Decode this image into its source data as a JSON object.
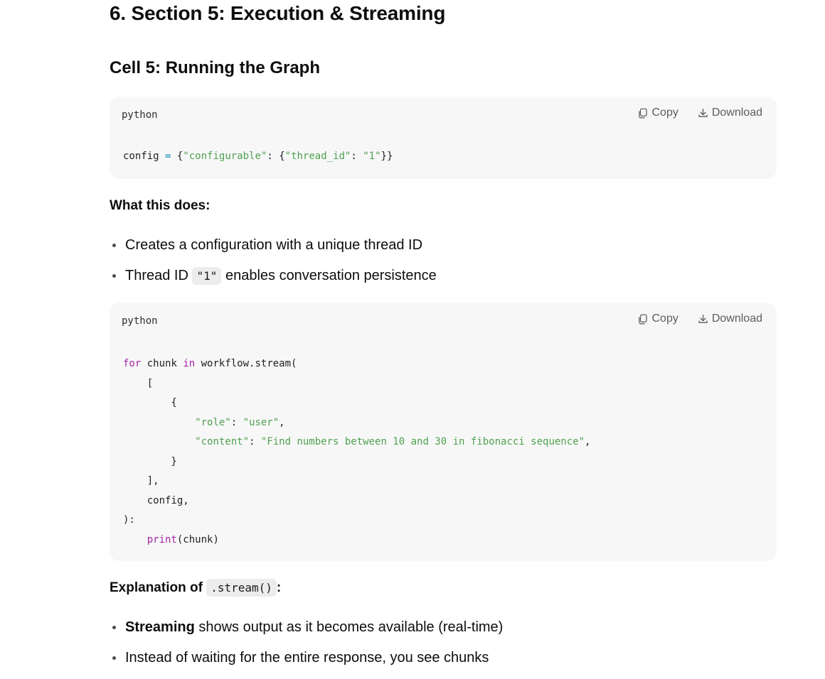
{
  "section_title": "6. Section 5: Execution & Streaming",
  "cell_title": "Cell 5: Running the Graph",
  "code_block_1": {
    "lang": "python",
    "copy_label": "Copy",
    "download_label": "Download",
    "tokens": [
      "config",
      " ",
      "=",
      " ",
      "{",
      "\"configurable\"",
      ": ",
      "{",
      "\"thread_id\"",
      ": ",
      "\"1\"",
      "}}"
    ]
  },
  "what_this_does": {
    "heading": "What this does:",
    "bullet_1": "Creates a configuration with a unique thread ID",
    "bullet_2_pre": "Thread ID ",
    "bullet_2_code": "\"1\"",
    "bullet_2_post": " enables conversation persistence"
  },
  "code_block_2": {
    "lang": "python",
    "copy_label": "Copy",
    "download_label": "Download",
    "l1_kw": "for",
    "l1_a": " chunk ",
    "l1_kw2": "in",
    "l1_b": " workflow.stream(",
    "l2": "    [",
    "l3": "        {",
    "l4_key": "\"role\"",
    "l4_sep": ": ",
    "l4_val": "\"user\"",
    "l4_end": ",",
    "l5_key": "\"content\"",
    "l5_sep": ": ",
    "l5_val": "\"Find numbers between 10 and 30 in fibonacci sequence\"",
    "l5_end": ",",
    "l6": "        }",
    "l7": "    ],",
    "l8": "    config,",
    "l9": "):",
    "l10_fn": "print",
    "l10_rest": "(chunk)"
  },
  "explanation": {
    "heading_pre": "Explanation of ",
    "heading_code": ".stream()",
    "heading_post": ":",
    "bullet_1_bold": "Streaming",
    "bullet_1_rest": " shows output as it becomes available (real-time)",
    "bullet_2": "Instead of waiting for the entire response, you see chunks"
  }
}
